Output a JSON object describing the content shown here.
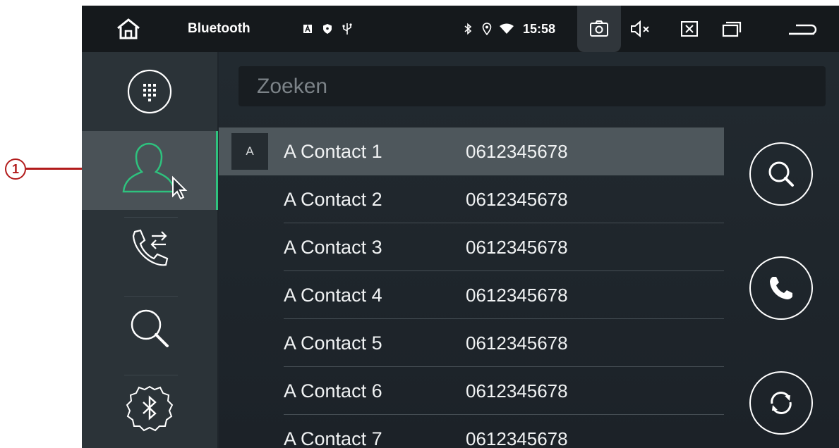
{
  "statusbar": {
    "title": "Bluetooth",
    "time": "15:58",
    "icons": [
      "home-icon",
      "app-a-icon",
      "shield-icon",
      "usb-icon",
      "bluetooth-icon",
      "location-icon",
      "wifi-icon",
      "screenshot-icon",
      "mute-icon",
      "close-box-icon",
      "recent-apps-icon",
      "back-icon"
    ]
  },
  "sidebar": {
    "items": [
      {
        "name": "dialpad",
        "icon": "dialpad-icon"
      },
      {
        "name": "contacts",
        "icon": "contact-icon",
        "active": true
      },
      {
        "name": "call-log",
        "icon": "call-transfer-icon"
      },
      {
        "name": "search",
        "icon": "search-icon"
      },
      {
        "name": "bluetooth-settings",
        "icon": "bluetooth-settings-icon"
      }
    ]
  },
  "search": {
    "placeholder": "Zoeken"
  },
  "contacts": {
    "index_letter": "A",
    "rows": [
      {
        "name": "A Contact 1",
        "phone": "0612345678"
      },
      {
        "name": "A Contact 2",
        "phone": "0612345678"
      },
      {
        "name": "A Contact 3",
        "phone": "0612345678"
      },
      {
        "name": "A Contact 4",
        "phone": "0612345678"
      },
      {
        "name": "A Contact 5",
        "phone": "0612345678"
      },
      {
        "name": "A Contact 6",
        "phone": "0612345678"
      },
      {
        "name": "A Contact 7",
        "phone": "0612345678"
      }
    ]
  },
  "actions": [
    "search-icon",
    "phone-icon",
    "sync-icon"
  ],
  "callout": {
    "number": "1"
  },
  "colors": {
    "accent": "#2ec27e",
    "callout": "#b21b1b"
  }
}
